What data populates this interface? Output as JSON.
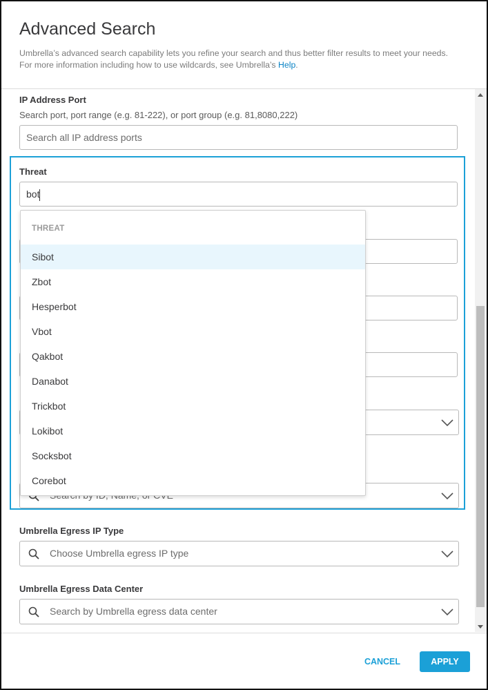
{
  "header": {
    "title": "Advanced Search",
    "description_line1": "Umbrella’s advanced search capability lets you refine your search and thus better filter results to meet your needs.",
    "description_line2": "For more information including how to use wildcards, see Umbrella’s",
    "help_link": "Help",
    "help_suffix": "."
  },
  "ip_port": {
    "label": "IP Address Port",
    "hint": "Search port, port range (e.g. 81-222), or port group (e.g. 81,8080,222)",
    "placeholder": "Search all IP address ports"
  },
  "threat": {
    "label": "Threat",
    "value": "bot",
    "hidden_placeholder": "Search by ID, Name, or CVE",
    "dropdown": {
      "header": "THREAT",
      "items": [
        "Sibot",
        "Zbot",
        "Hesperbot",
        "Vbot",
        "Qakbot",
        "Danabot",
        "Trickbot",
        "Lokibot",
        "Socksbot",
        "Corebot"
      ]
    }
  },
  "egress_ip_type": {
    "label": "Umbrella Egress IP Type",
    "placeholder": "Choose Umbrella egress IP type"
  },
  "egress_data_center": {
    "label": "Umbrella Egress Data Center",
    "placeholder": "Search by Umbrella egress data center"
  },
  "footer": {
    "cancel_label": "CANCEL",
    "apply_label": "APPLY"
  },
  "colors": {
    "accent": "#1ba0d7",
    "link": "#0a83c5",
    "highlight": "#e8f6fd"
  }
}
